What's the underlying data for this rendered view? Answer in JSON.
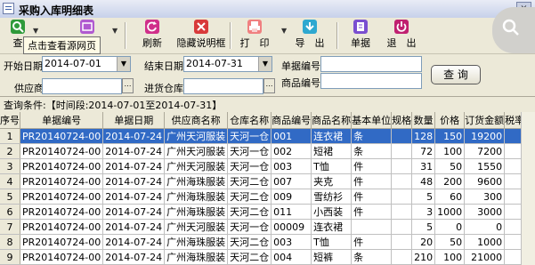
{
  "window": {
    "title": "采购入库明细表",
    "close_label": "×"
  },
  "toolbar": {
    "buttons": [
      {
        "label": "查",
        "icon": "search-icon",
        "color": "#2e9a3a"
      },
      {
        "label": "",
        "icon": "view-icon",
        "color": "#b05ad0"
      },
      {
        "label": "刷新",
        "icon": "refresh-icon",
        "color": "#d02f8a"
      },
      {
        "label": "隐藏说明框",
        "icon": "hide-icon",
        "color": "#d83a3a"
      },
      {
        "label": "打　印",
        "icon": "print-icon",
        "color": "#f08080"
      },
      {
        "label": "导　出",
        "icon": "export-icon",
        "color": "#2ea8d0"
      },
      {
        "label": "单据",
        "icon": "document-icon",
        "color": "#7a4fd0"
      },
      {
        "label": "退　出",
        "icon": "exit-icon",
        "color": "#c02070"
      }
    ],
    "dropdown_glyph": "▼"
  },
  "tooltip": "点击查看源网页",
  "filters": {
    "start_label": "开始日期",
    "start_value": "2014-07-01",
    "end_label": "结束日期",
    "end_value": "2014-07-31",
    "doc_label": "单据编号",
    "doc_value": "",
    "supplier_label": "供应商",
    "supplier_value": "",
    "warehouse_label": "进货仓库",
    "warehouse_value": "",
    "product_label": "商品编号",
    "product_value": "",
    "browse_glyph": "…",
    "query_label": "查 询"
  },
  "condition": "查询条件:【时间段:2014-07-01至2014-07-31】",
  "grid": {
    "columns": [
      "序号",
      "单据编号",
      "单据日期",
      "供应商名称",
      "仓库名称",
      "商品编号",
      "商品名称",
      "基本单位",
      "规格",
      "数量",
      "价格",
      "订货金额",
      "税率"
    ],
    "rows": [
      [
        "1",
        "PR20140724-00",
        "2014-07-24",
        "广州天河服装",
        "天河一仓",
        "001",
        "连衣裙",
        "条",
        "",
        "128",
        "150",
        "19200",
        ""
      ],
      [
        "2",
        "PR20140724-00",
        "2014-07-24",
        "广州天河服装",
        "天河一仓",
        "002",
        "短裙",
        "条",
        "",
        "72",
        "100",
        "7200",
        ""
      ],
      [
        "3",
        "PR20140724-00",
        "2014-07-24",
        "广州天河服装",
        "天河一仓",
        "003",
        "T恤",
        "件",
        "",
        "31",
        "50",
        "1550",
        ""
      ],
      [
        "4",
        "PR20140724-00",
        "2014-07-24",
        "广州海珠服装",
        "天河二仓",
        "007",
        "夹克",
        "件",
        "",
        "48",
        "200",
        "9600",
        ""
      ],
      [
        "5",
        "PR20140724-00",
        "2014-07-24",
        "广州海珠服装",
        "天河二仓",
        "009",
        "雪纺衫",
        "件",
        "",
        "5",
        "60",
        "300",
        ""
      ],
      [
        "6",
        "PR20140724-00",
        "2014-07-24",
        "广州海珠服装",
        "天河二仓",
        "011",
        "小西装",
        "件",
        "",
        "3",
        "1000",
        "3000",
        ""
      ],
      [
        "7",
        "PR20140724-00",
        "2014-07-24",
        "广州天河服装",
        "天河一仓",
        "00009",
        "连衣裙",
        "",
        "",
        "5",
        "0",
        "0",
        ""
      ],
      [
        "8",
        "PR20140724-00",
        "2014-07-24",
        "广州海珠服装",
        "天河二仓",
        "003",
        "T恤",
        "件",
        "",
        "20",
        "50",
        "1000",
        ""
      ],
      [
        "9",
        "PR20140724-00",
        "2014-07-24",
        "广州海珠服装",
        "天河二仓",
        "004",
        "短裤",
        "条",
        "",
        "210",
        "100",
        "21000",
        ""
      ]
    ],
    "selected_row": 0,
    "row_pointer": "▸"
  }
}
